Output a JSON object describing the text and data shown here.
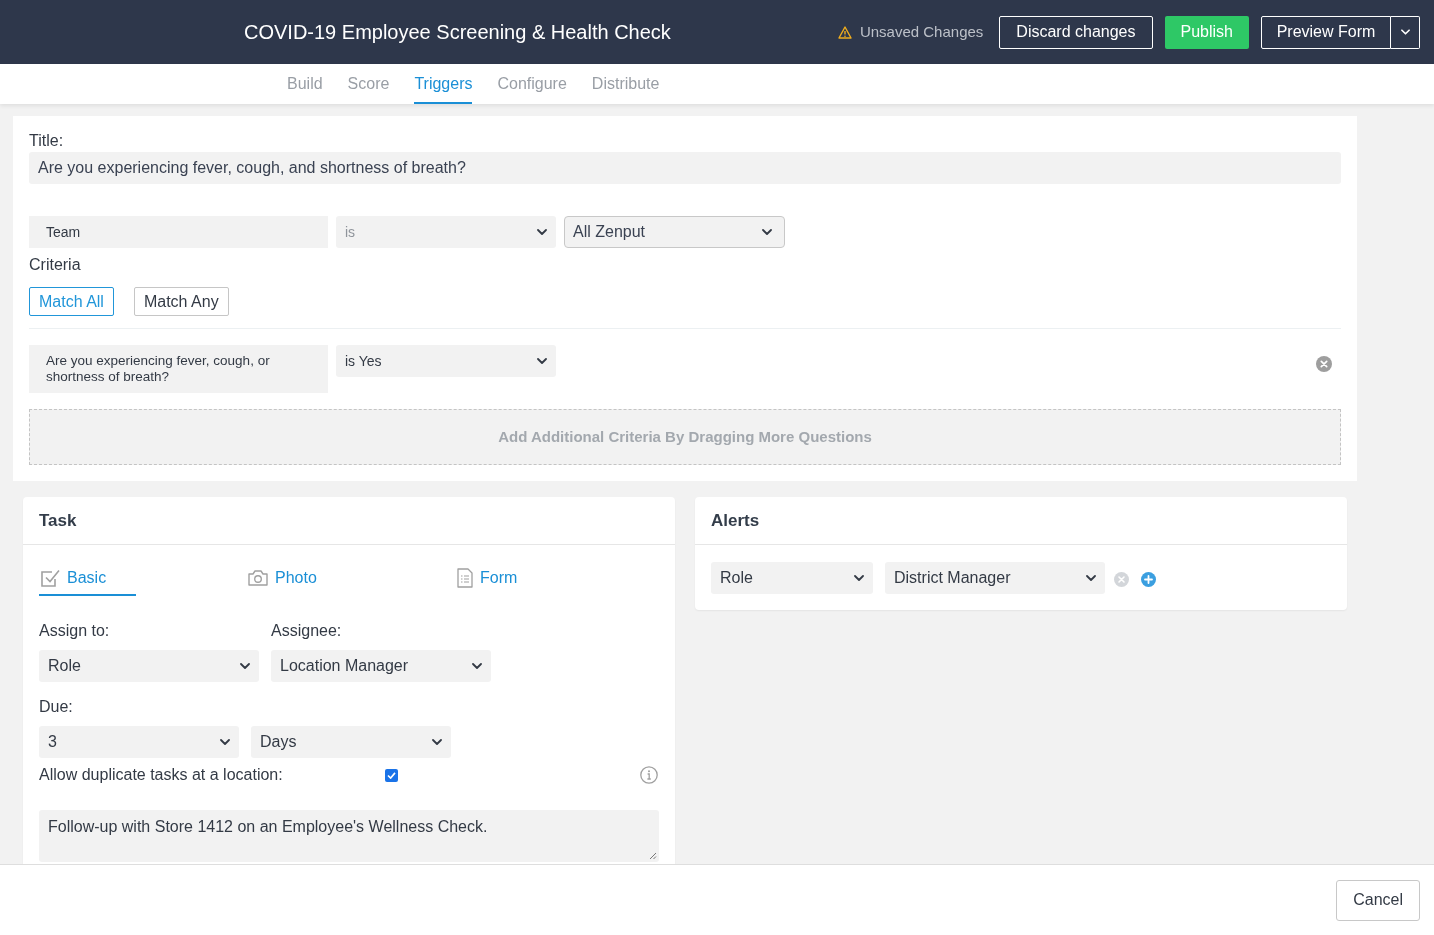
{
  "header": {
    "title": "COVID-19 Employee Screening & Health Check",
    "notice": "Unsaved Changes",
    "buttons": [
      {
        "label": "Discard changes",
        "kind": "outline"
      },
      {
        "label": "Publish",
        "kind": "primary"
      },
      {
        "label": "Preview Form",
        "kind": "split"
      }
    ]
  },
  "tabs": [
    {
      "label": "Build",
      "selected": false
    },
    {
      "label": "Score",
      "selected": false
    },
    {
      "label": "Triggers",
      "selected": true
    },
    {
      "label": "Configure",
      "selected": false
    },
    {
      "label": "Distribute",
      "selected": false
    }
  ],
  "trigger": {
    "title_label": "Title:",
    "title": "Are you experiencing fever, cough, and shortness of breath?",
    "scope": {
      "field": "Team",
      "operator": {
        "value": "is",
        "disabled": true
      },
      "value": "All Zenput"
    },
    "criteria_label": "Criteria",
    "match": [
      {
        "label": "Match All",
        "selected": true
      },
      {
        "label": "Match Any",
        "selected": false
      }
    ],
    "criteria": [
      {
        "question": "Are you experiencing fever, cough, or shortness of breath?",
        "condition": "is Yes"
      }
    ],
    "drop_zone": "Add Additional Criteria By Dragging More Questions"
  },
  "task": {
    "heading": "Task",
    "tabs": [
      {
        "label": "Basic",
        "selected": true
      },
      {
        "label": "Photo",
        "selected": false
      },
      {
        "label": "Form",
        "selected": false
      }
    ],
    "assign_to": {
      "label": "Assign to:",
      "value": "Role"
    },
    "assignee": {
      "label": "Assignee:",
      "value": "Location Manager"
    },
    "due": {
      "label": "Due:",
      "amount": "3",
      "unit": "Days"
    },
    "allow_duplicates": {
      "label": "Allow duplicate tasks at a location:",
      "checked": true
    },
    "description": "Follow-up with Store 1412 on an Employee's Wellness Check."
  },
  "alerts": {
    "heading": "Alerts",
    "rows": [
      {
        "type": "Role",
        "recipient": "District Manager"
      }
    ]
  },
  "footer": {
    "buttons": [
      {
        "label": "Cancel"
      }
    ]
  }
}
